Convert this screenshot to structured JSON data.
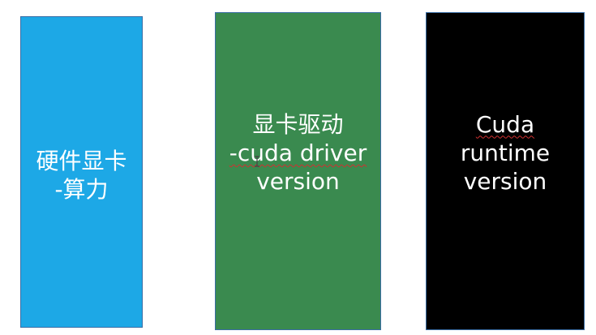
{
  "boxes": [
    {
      "lines": [
        "硬件显卡",
        "-算力"
      ],
      "color": "#1da8e6"
    },
    {
      "lines": [
        "显卡驱动",
        "-cuda driver",
        "version"
      ],
      "color": "#3a8a4f"
    },
    {
      "lines": [
        "Cuda",
        "runtime",
        "version"
      ],
      "color": "#000000"
    }
  ],
  "cursor_icon": "text-cursor-icon"
}
